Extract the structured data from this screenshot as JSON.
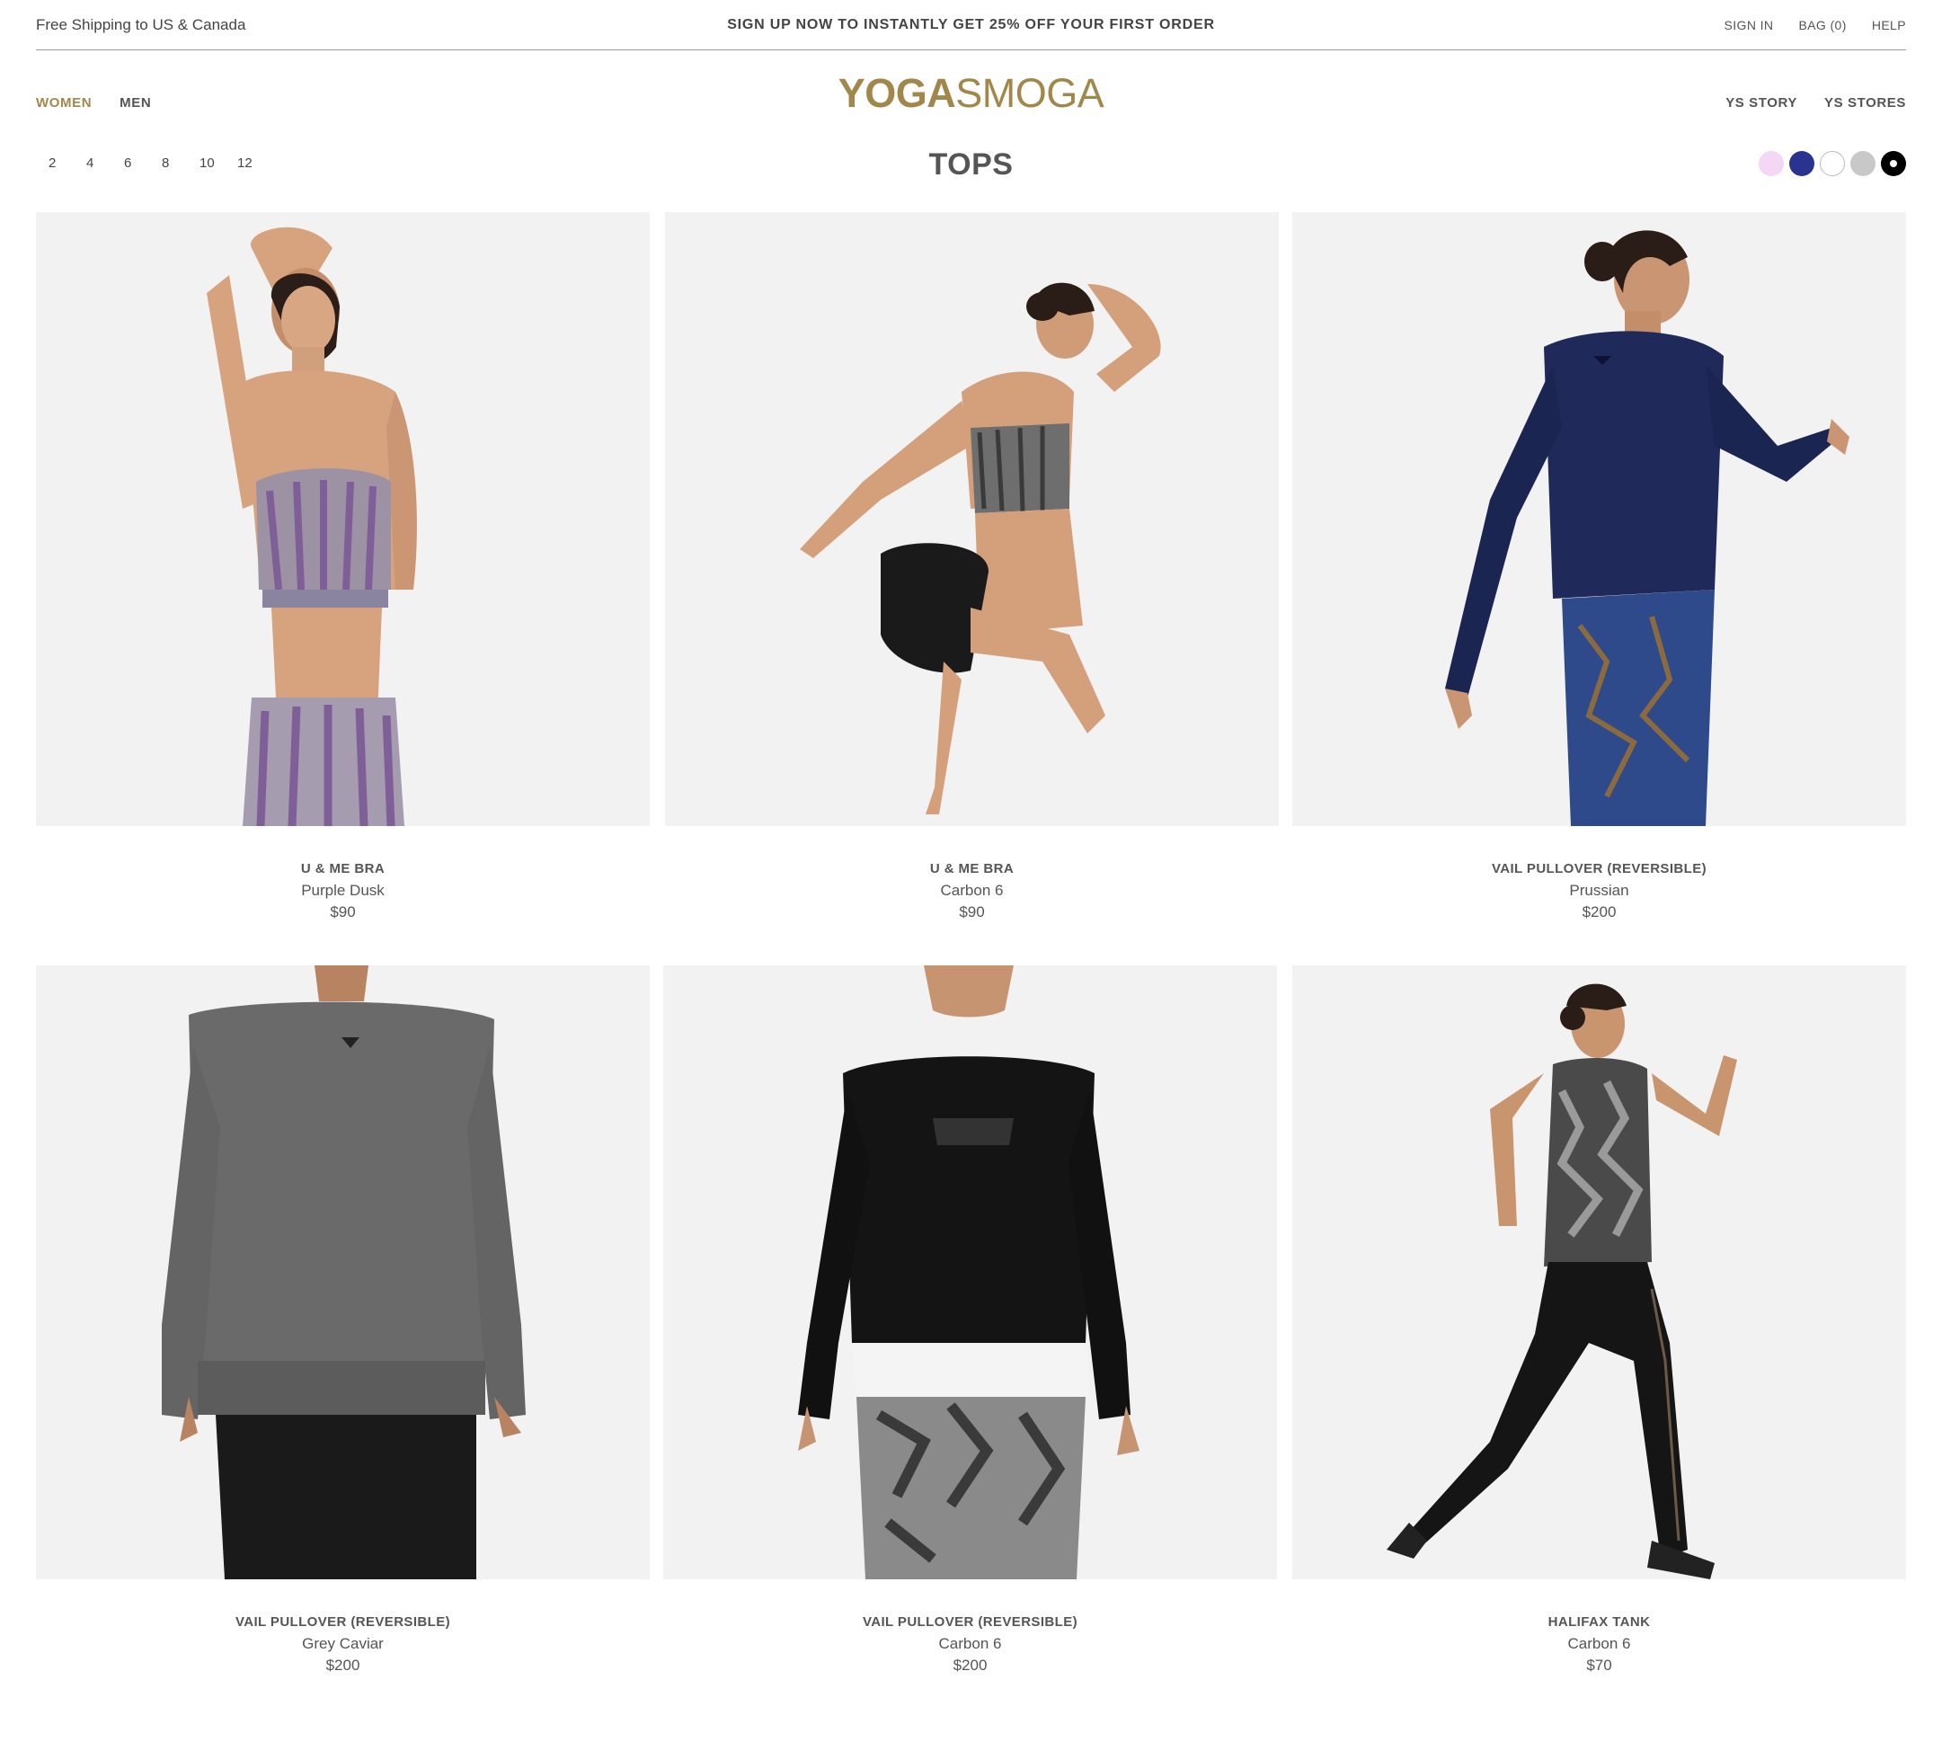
{
  "topbar": {
    "shipping": "Free Shipping to US & Canada",
    "promo": "SIGN UP NOW TO INSTANTLY GET 25% OFF YOUR FIRST ORDER",
    "sign_in": "SIGN IN",
    "bag": "BAG (0)",
    "help": "HELP"
  },
  "nav": {
    "women": "WOMEN",
    "men": "MEN",
    "logo_part1": "YOGA",
    "logo_part2": "SMOGA",
    "story": "YS STORY",
    "stores": "YS STORES"
  },
  "page": {
    "title": "TOPS"
  },
  "sizes": [
    "2",
    "4",
    "6",
    "8",
    "10",
    "12"
  ],
  "swatches": [
    {
      "name": "pink",
      "color": "#f4d6f6"
    },
    {
      "name": "navy",
      "color": "#2a3490"
    },
    {
      "name": "white",
      "color": "#ffffff"
    },
    {
      "name": "grey",
      "color": "#c8c8c8"
    },
    {
      "name": "black",
      "color": "#000000",
      "selected": true
    }
  ],
  "colors": {
    "accent": "#a2874b",
    "tile_bg": "#f2f2f2"
  },
  "products": [
    {
      "name": "U & ME BRA",
      "color": "Purple Dusk",
      "price": "$90"
    },
    {
      "name": "U & ME BRA",
      "color": "Carbon 6",
      "price": "$90"
    },
    {
      "name": "VAIL PULLOVER (REVERSIBLE)",
      "color": "Prussian",
      "price": "$200"
    },
    {
      "name": "VAIL PULLOVER (REVERSIBLE)",
      "color": "Grey Caviar",
      "price": "$200"
    },
    {
      "name": "VAIL PULLOVER (REVERSIBLE)",
      "color": "Carbon 6",
      "price": "$200"
    },
    {
      "name": "HALIFAX TANK",
      "color": "Carbon 6",
      "price": "$70"
    }
  ]
}
